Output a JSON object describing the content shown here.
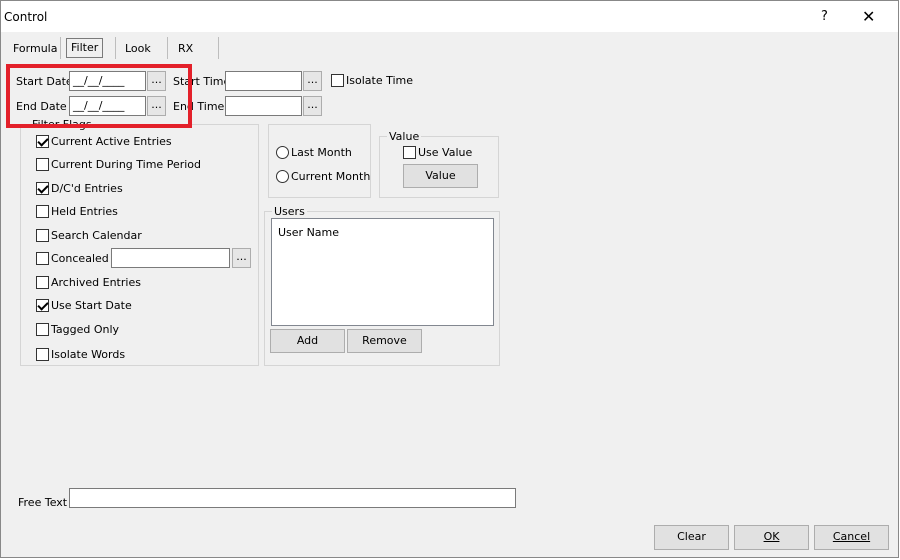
{
  "window": {
    "title": "Control",
    "help_label": "?",
    "close_label": "✕"
  },
  "tabs": [
    {
      "label": "Formula"
    },
    {
      "label": "Filter",
      "active": true
    },
    {
      "label": "Look"
    },
    {
      "label": "RX"
    }
  ],
  "dates": {
    "start_date_label": "Start Date",
    "start_date_value": "__/__/____",
    "end_date_label": "End Date",
    "end_date_value": "__/__/____",
    "start_time_label": "Start Time",
    "start_time_value": "",
    "end_time_label": "End Time",
    "end_time_value": "",
    "isolate_time_label": "Isolate Time",
    "isolate_time_checked": false,
    "picker_label": "..."
  },
  "filter_flags": {
    "title": "Filter Flags",
    "items": [
      {
        "label": "Current Active Entries",
        "checked": true
      },
      {
        "label": "Current During Time Period",
        "checked": false
      },
      {
        "label": "D/C'd Entries",
        "checked": true
      },
      {
        "label": "Held Entries",
        "checked": false
      },
      {
        "label": "Search Calendar",
        "checked": false
      },
      {
        "label": "Concealed",
        "checked": false
      },
      {
        "label": "Archived Entries",
        "checked": false
      },
      {
        "label": "Use Start Date",
        "checked": true
      },
      {
        "label": "Tagged Only",
        "checked": false
      },
      {
        "label": "Isolate Words",
        "checked": false
      }
    ],
    "concealed_value": ""
  },
  "period": {
    "options": [
      {
        "label": "Last Month",
        "selected": false
      },
      {
        "label": "Current Month",
        "selected": false
      }
    ]
  },
  "value_group": {
    "title": "Value",
    "use_value_label": "Use Value",
    "use_value_checked": false,
    "value_button": "Value"
  },
  "users": {
    "title": "Users",
    "items": [
      "User Name"
    ],
    "add_button": "Add",
    "remove_button": "Remove"
  },
  "free_text": {
    "label": "Free Text",
    "value": ""
  },
  "footer": {
    "clear_button": "Clear",
    "ok_button": "OK",
    "cancel_button": "Cancel"
  },
  "colors": {
    "highlight": "#e3202a",
    "dialog_bg": "#f0f0f0"
  }
}
